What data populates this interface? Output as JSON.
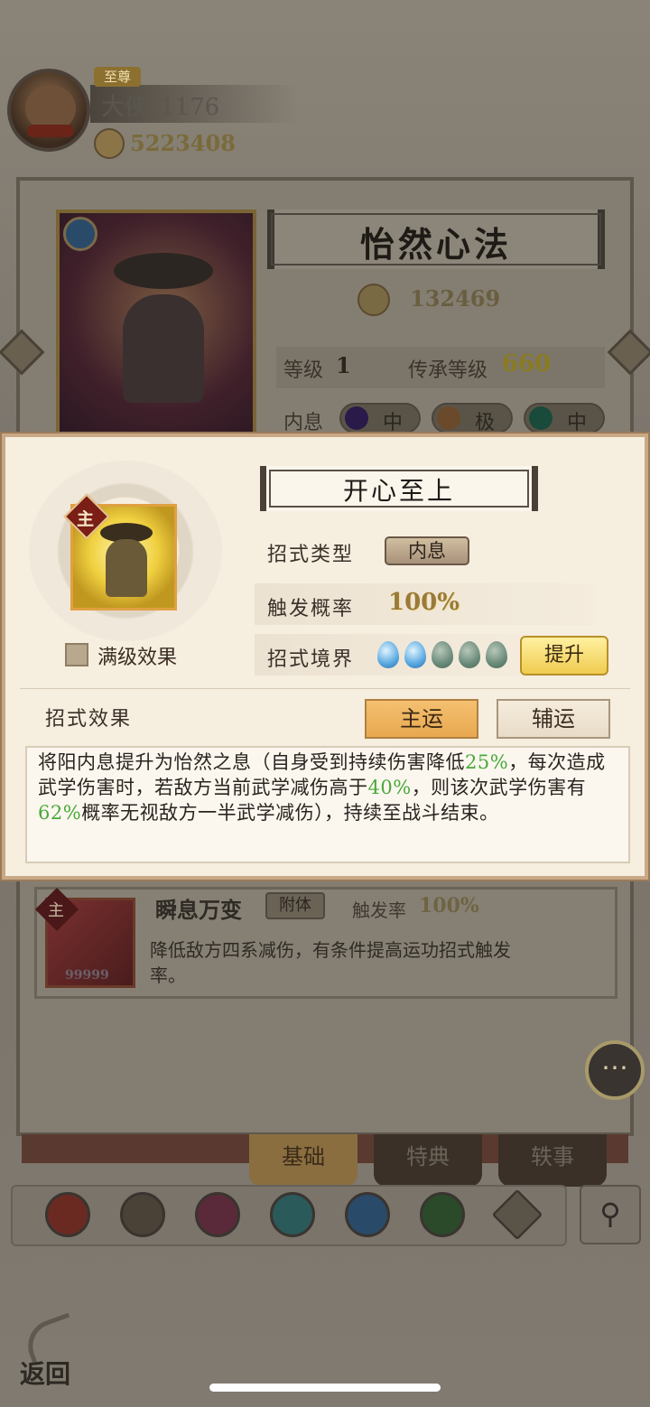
{
  "player": {
    "vip_label": "至尊",
    "name": "大侠_1176",
    "power": "5223408"
  },
  "skill_card": {
    "title": "怡然心法",
    "power": "132469",
    "level_label": "等级",
    "level_value": "1",
    "inherit_label": "传承等级",
    "inherit_value": "660",
    "neixi_label": "内息",
    "neixi_slots": [
      {
        "grade": "中",
        "color": "#2a1a4a"
      },
      {
        "grade": "极",
        "color": "#6a4a2a"
      },
      {
        "grade": "中",
        "color": "#1a4a3a"
      }
    ]
  },
  "popup": {
    "main_badge": "主",
    "max_level_label": "满级效果",
    "title": "开心至上",
    "type_label": "招式类型",
    "type_value": "内息",
    "rate_label": "触发概率",
    "rate_value": "100%",
    "realm_label": "招式境界",
    "realm_total": 5,
    "realm_level": 2,
    "upgrade_label": "提升",
    "effect_label": "招式效果",
    "main_luck_label": "主运",
    "sub_luck_label": "辅运",
    "description": {
      "p1": "将阳内息提升为怡然之息（自身受到持续伤害降低",
      "v1": "25%",
      "p2": "，每次造成武学伤害时，若敌方当前武学减伤高于",
      "v2": "40%",
      "p3": "，则该次武学伤害有",
      "v3": "62%",
      "p4": "概率无视敌方一半武学减伤），持续至战斗结束。"
    }
  },
  "skill2": {
    "main_badge": "主",
    "number": "99999",
    "name": "瞬息万变",
    "tag": "附体",
    "rate_label": "触发率",
    "rate_value": "100%",
    "description": "降低敌方四系减伤，有条件提高运功招式触发率。"
  },
  "tabs": [
    "基础",
    "特典",
    "轶事"
  ],
  "school_icons": [
    {
      "name": "blade-school-icon",
      "color": "#6a2a22"
    },
    {
      "name": "sword-school-icon",
      "color": "#4a4236"
    },
    {
      "name": "fist-school-icon",
      "color": "#5a2a3a"
    },
    {
      "name": "lotus-school-icon",
      "color": "#2a5a5a"
    },
    {
      "name": "taiji-school-icon",
      "color": "#2a4a6a"
    },
    {
      "name": "staff-school-icon",
      "color": "#2a4a2a"
    },
    {
      "name": "all-school-icon",
      "color": "#5a5448"
    }
  ],
  "icons": {
    "search": "search-icon",
    "chat": "chat-icon",
    "back": "back-icon"
  },
  "back_label": "返回",
  "colors": {
    "highlight_green": "#4aa83a",
    "gold_button": "#f0cc50",
    "popup_bg": "#f6eedf"
  }
}
